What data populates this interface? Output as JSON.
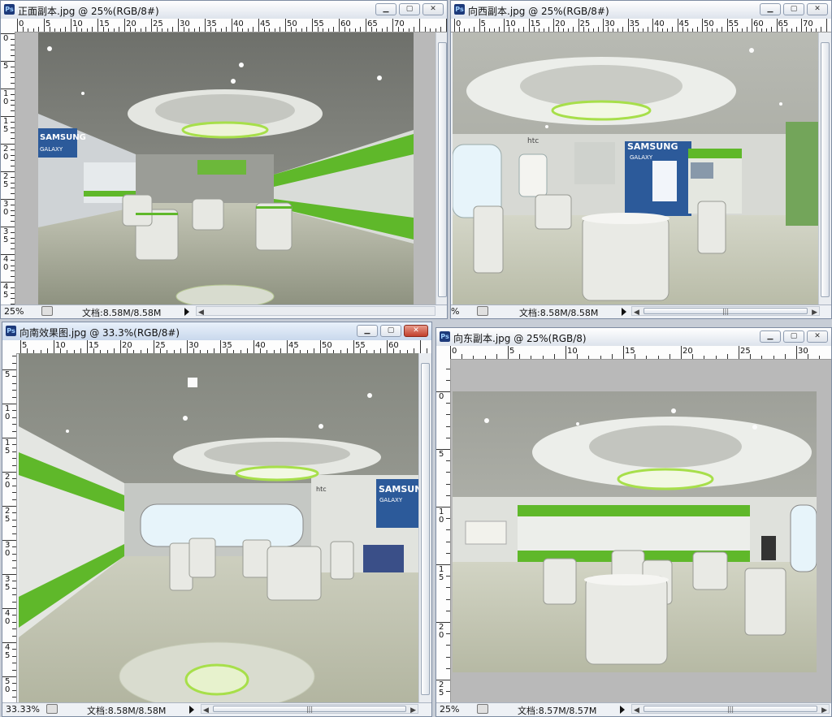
{
  "windows": [
    {
      "id": "w1",
      "title": "正面副本.jpg @ 25%(RGB/8#)",
      "zoom": "25%",
      "doc": "文档:8.58M/8.58M",
      "ruler_h": [
        "0",
        "5",
        "10",
        "15",
        "20",
        "25",
        "30",
        "35",
        "40",
        "45",
        "50",
        "55",
        "60",
        "65",
        "70"
      ],
      "ruler_v": [
        "0",
        "5",
        "10",
        "15",
        "20",
        "25",
        "30",
        "35",
        "40",
        "45"
      ],
      "active": false
    },
    {
      "id": "w2",
      "title": "向西副本.jpg @ 25%(RGB/8#)",
      "zoom": "%",
      "doc": "文档:8.58M/8.58M",
      "ruler_h": [
        "0",
        "5",
        "10",
        "15",
        "20",
        "25",
        "30",
        "35",
        "40",
        "45",
        "50",
        "55",
        "60",
        "65",
        "70"
      ],
      "ruler_v": [],
      "active": false
    },
    {
      "id": "w3",
      "title": "向南效果图.jpg @ 33.3%(RGB/8#)",
      "zoom": "33.33%",
      "doc": "文档:8.58M/8.58M",
      "ruler_h": [
        "5",
        "10",
        "15",
        "20",
        "25",
        "30",
        "35",
        "40",
        "45",
        "50",
        "55",
        "60"
      ],
      "ruler_v": [
        "5",
        "10",
        "15",
        "20",
        "25",
        "30",
        "35",
        "40",
        "45",
        "50"
      ],
      "active": true
    },
    {
      "id": "w4",
      "title": "向东副本.jpg @ 25%(RGB/8)",
      "zoom": "25%",
      "doc": "文档:8.57M/8.57M",
      "ruler_h": [
        "0",
        "5",
        "10",
        "15",
        "20",
        "25",
        "30"
      ],
      "ruler_v": [
        "0",
        "5",
        "10",
        "15",
        "20",
        "25"
      ],
      "active": false
    }
  ],
  "render_labels": {
    "brand_samsung": "SAMSUNG",
    "brand_galaxy": "GALAXY",
    "brand_htc": "htc"
  },
  "colors": {
    "accent_green": "#5fb82a",
    "floor": "#b9bca8",
    "ceiling": "#8e918b",
    "close_red": "#c2402c"
  }
}
